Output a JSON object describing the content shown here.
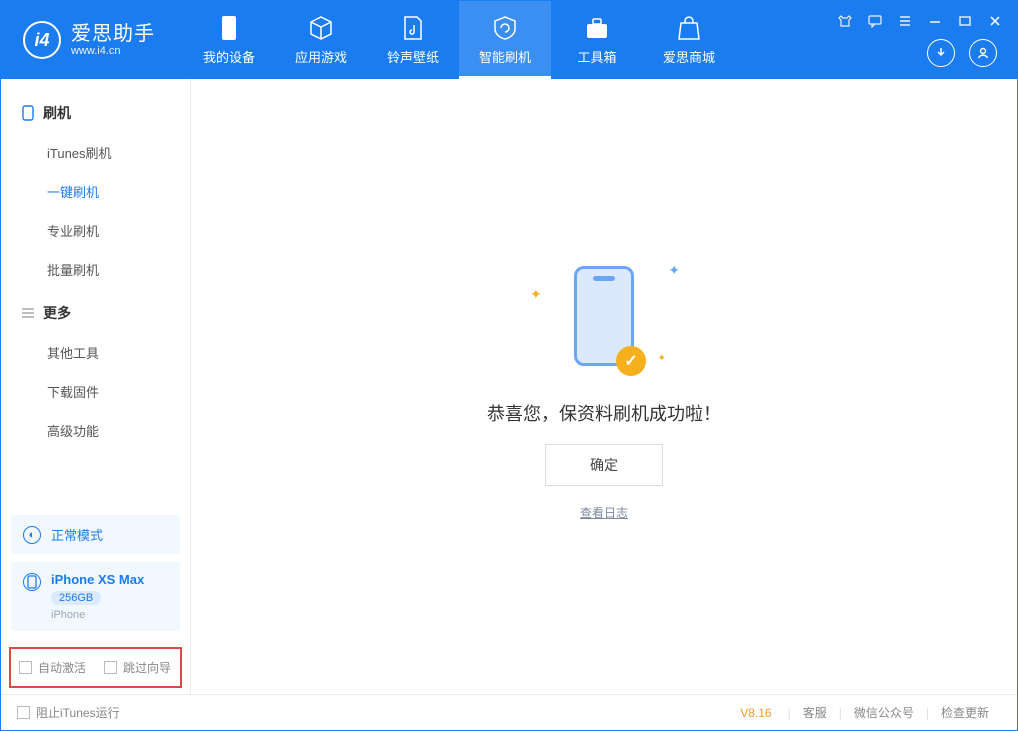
{
  "app": {
    "title": "爱思助手",
    "subtitle": "www.i4.cn"
  },
  "nav": {
    "items": [
      {
        "label": "我的设备"
      },
      {
        "label": "应用游戏"
      },
      {
        "label": "铃声壁纸"
      },
      {
        "label": "智能刷机"
      },
      {
        "label": "工具箱"
      },
      {
        "label": "爱思商城"
      }
    ],
    "activeIndex": 3
  },
  "sidebar": {
    "section1": {
      "title": "刷机",
      "items": [
        "iTunes刷机",
        "一键刷机",
        "专业刷机",
        "批量刷机"
      ],
      "activeIndex": 1
    },
    "section2": {
      "title": "更多",
      "items": [
        "其他工具",
        "下载固件",
        "高级功能"
      ]
    }
  },
  "device": {
    "mode": "正常模式",
    "name": "iPhone XS Max",
    "capacity": "256GB",
    "type": "iPhone"
  },
  "checks": {
    "auto_activate": "自动激活",
    "skip_guide": "跳过向导"
  },
  "main": {
    "message": "恭喜您，保资料刷机成功啦！",
    "ok": "确定",
    "view_log": "查看日志"
  },
  "status": {
    "block_itunes": "阻止iTunes运行",
    "version": "V8.16",
    "links": [
      "客服",
      "微信公众号",
      "检查更新"
    ]
  }
}
